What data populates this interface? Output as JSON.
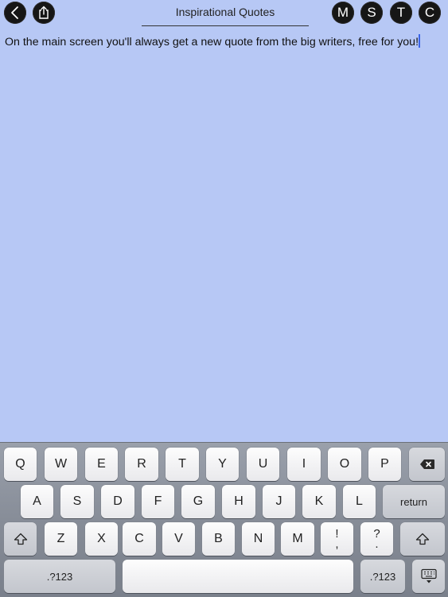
{
  "app": {
    "title": "Inspirational Quotes"
  },
  "toolbar": {
    "back_icon": "chevron-left-icon",
    "share_icon": "share-icon",
    "letters": [
      "M",
      "S",
      "T",
      "C"
    ]
  },
  "editor": {
    "text": "On the main screen you'll always get a new quote from the big writers, free for you!"
  },
  "keyboard": {
    "row1": [
      "Q",
      "W",
      "E",
      "R",
      "T",
      "Y",
      "U",
      "I",
      "O",
      "P"
    ],
    "row2": [
      "A",
      "S",
      "D",
      "F",
      "G",
      "H",
      "J",
      "K",
      "L"
    ],
    "row3": [
      "Z",
      "X",
      "C",
      "V",
      "B",
      "N",
      "M"
    ],
    "return_label": "return",
    "punct1_top": "!",
    "punct1_bottom": ",",
    "punct2_top": "?",
    "punct2_bottom": ".",
    "numbers_label": ".?123",
    "backspace_icon": "backspace-icon",
    "shift_icon": "shift-icon",
    "dismiss_icon": "keyboard-dismiss-icon"
  },
  "colors": {
    "background": "#b7c8f5",
    "caret": "#3a64e8",
    "button": "#161616"
  }
}
